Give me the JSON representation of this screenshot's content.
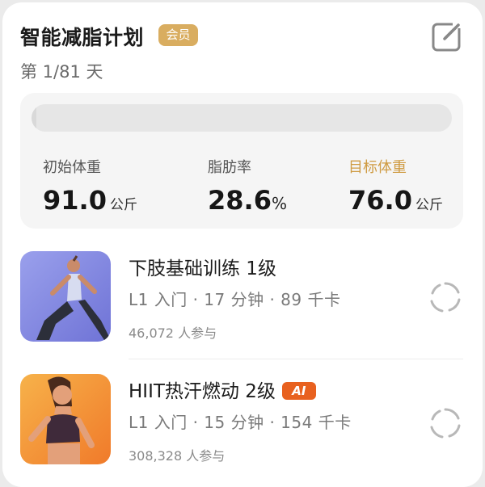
{
  "plan": {
    "title": "智能减脂计划",
    "member_badge": "会员",
    "day_text": "第 1/81 天",
    "progress_fraction": 0.0123
  },
  "stats": {
    "initial": {
      "label": "初始体重",
      "value": "91.0",
      "unit": "公斤"
    },
    "bodyfat": {
      "label": "脂肪率",
      "value": "28.6",
      "unit": "%"
    },
    "target": {
      "label": "目标体重",
      "value": "76.0",
      "unit": "公斤"
    },
    "accent_color": "#cf9b42"
  },
  "courses": [
    {
      "name": "下肢基础训练 1级",
      "meta": "L1 入门 · 17 分钟 · 89 千卡",
      "participants": "46,072 人参与"
    },
    {
      "name": "HIIT热汗燃动 2级",
      "ai_badge": "AI",
      "meta": "L1 入门 · 15 分钟 · 154 千卡",
      "participants": "308,328 人参与"
    }
  ],
  "icons": {
    "edit": "edit-icon",
    "sync": "sync-icon"
  }
}
